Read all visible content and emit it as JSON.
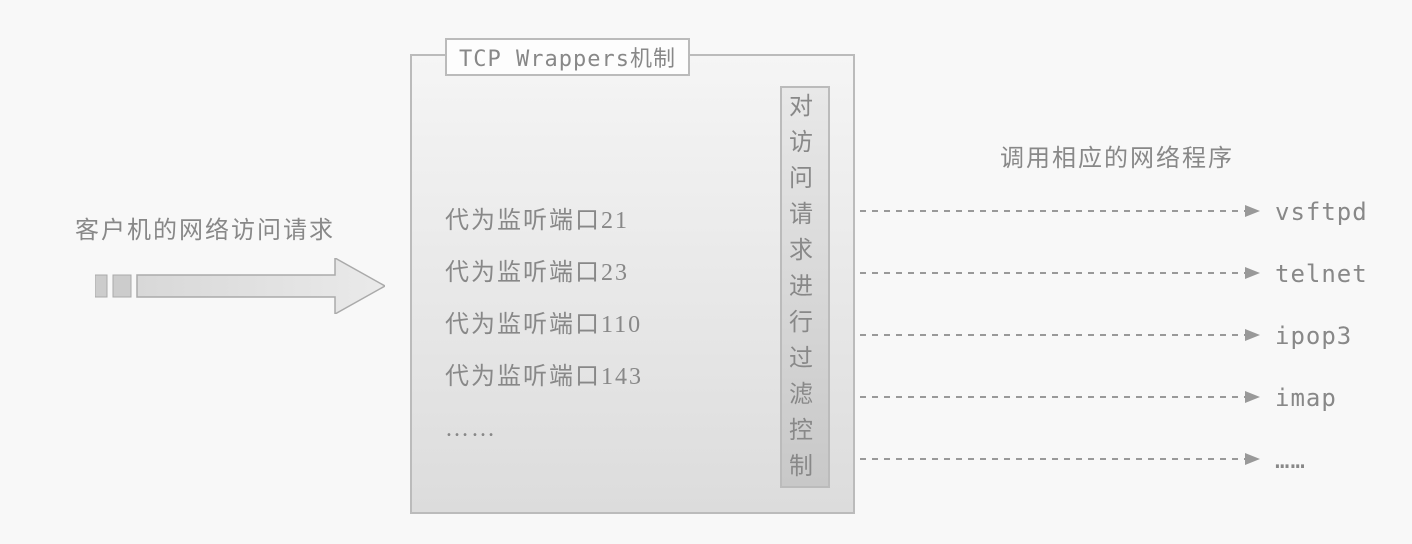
{
  "client_label": "客户机的网络访问请求",
  "title_box": "TCP Wrappers机制",
  "ports": [
    "代为监听端口21",
    "代为监听端口23",
    "代为监听端口110",
    "代为监听端口143",
    "……"
  ],
  "filter_text": "对访问请求进行过滤控制",
  "output_title": "调用相应的网络程序",
  "outputs": [
    {
      "label": "vsftpd"
    },
    {
      "label": "telnet"
    },
    {
      "label": "ipop3"
    },
    {
      "label": "imap"
    },
    {
      "label": "……"
    }
  ],
  "colors": {
    "line": "#999",
    "text": "#888"
  }
}
